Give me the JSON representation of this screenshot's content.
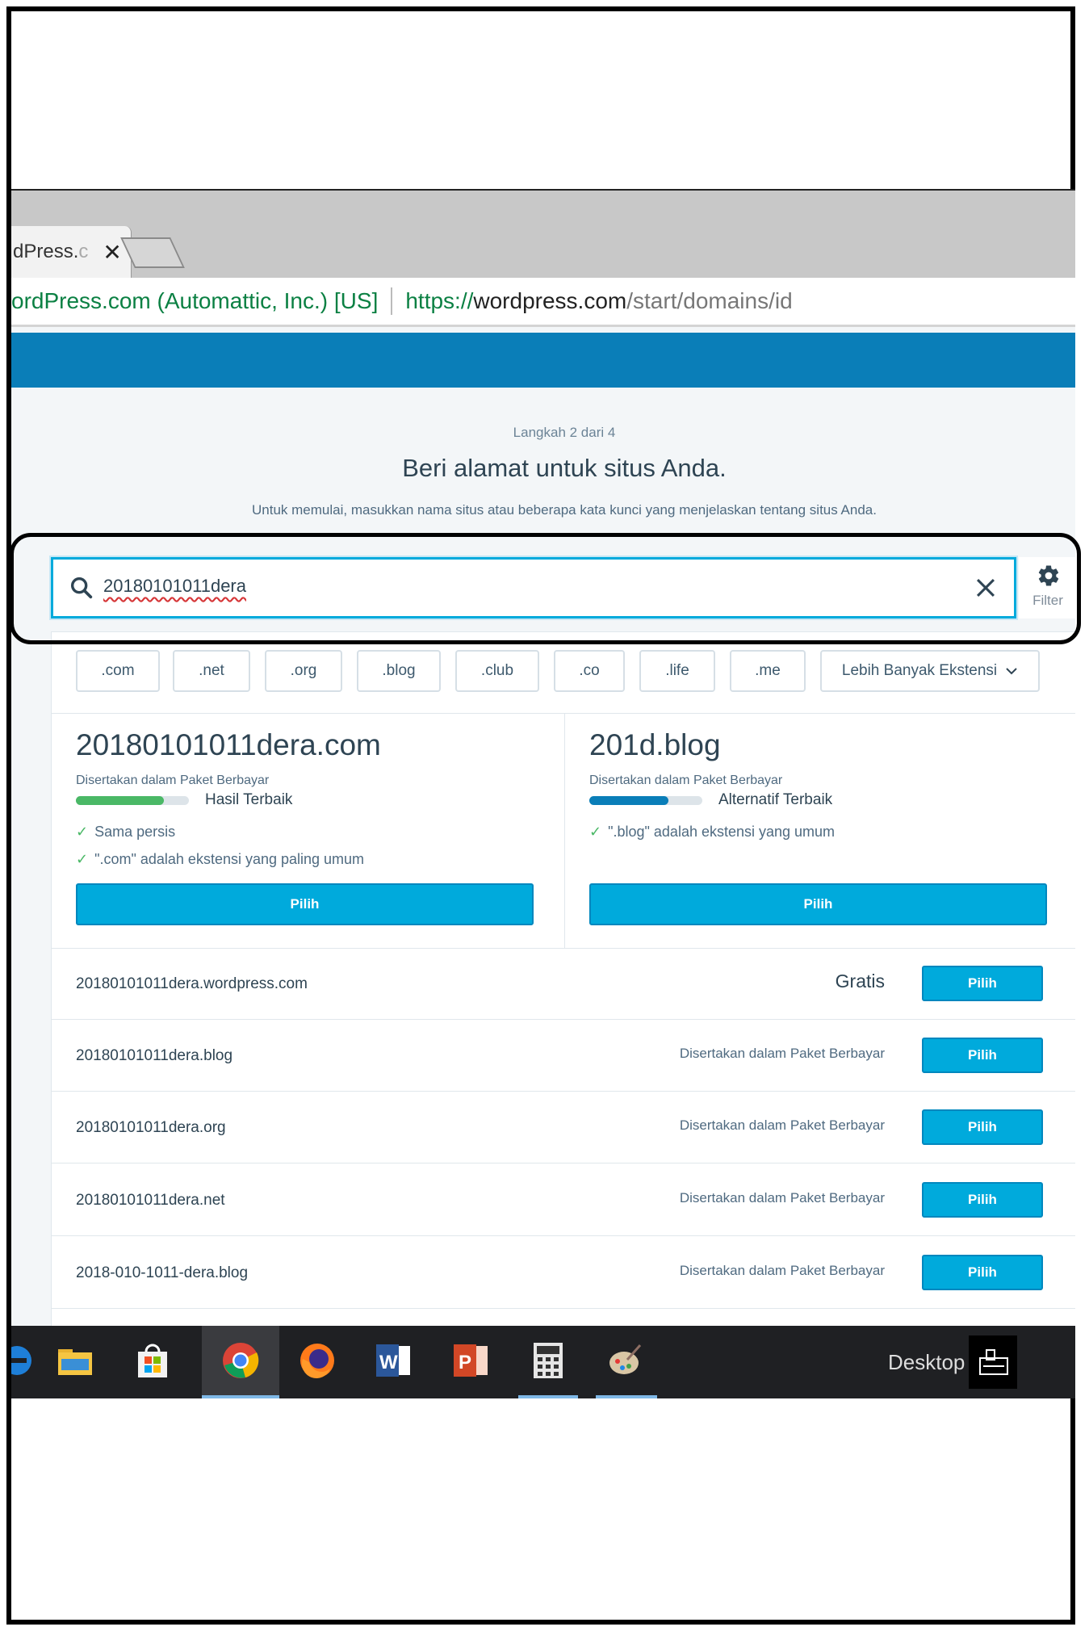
{
  "browser": {
    "tab_title_visible": "dPress.",
    "tab_title_fade": "c",
    "tab_close": "✕",
    "secure_label": "ordPress.com (Automattic, Inc.) [US]",
    "url_proto": "https://",
    "url_host": "wordpress.com",
    "url_path": "/start/domains/id"
  },
  "page": {
    "step": "Langkah 2 dari 4",
    "headline": "Beri alamat untuk situs Anda.",
    "subhead": "Untuk memulai, masukkan nama situs atau beberapa kata kunci yang menjelaskan tentang situs Anda."
  },
  "search": {
    "value": "20180101011dera",
    "filter_label": "Filter"
  },
  "tlds": [
    ".com",
    ".net",
    ".org",
    ".blog",
    ".club",
    ".co",
    ".life",
    ".me"
  ],
  "more_extensions": "Lebih Banyak Ekstensi",
  "featured": [
    {
      "name": "20180101011dera.com",
      "sub": "Disertakan dalam Paket Berbayar",
      "badge": "Hasil Terbaik",
      "score": 0.78,
      "bar_color": "#4ab866",
      "checks": [
        "Sama persis",
        "\".com\" adalah ekstensi yang paling umum"
      ],
      "button": "Pilih"
    },
    {
      "name": "201d.blog",
      "sub": "Disertakan dalam Paket Berbayar",
      "badge": "Alternatif Terbaik",
      "score": 0.7,
      "bar_color": "#0a7eb8",
      "checks": [
        "\".blog\" adalah ekstensi yang umum"
      ],
      "button": "Pilih"
    }
  ],
  "results": [
    {
      "name": "20180101011dera.wordpress.com",
      "price": "Gratis",
      "button": "Pilih"
    },
    {
      "name": "20180101011dera.blog",
      "price": "Disertakan dalam Paket Berbayar",
      "button": "Pilih"
    },
    {
      "name": "20180101011dera.org",
      "price": "Disertakan dalam Paket Berbayar",
      "button": "Pilih"
    },
    {
      "name": "20180101011dera.net",
      "price": "Disertakan dalam Paket Berbayar",
      "button": "Pilih"
    },
    {
      "name": "2018-010-1011-dera.blog",
      "price": "Disertakan dalam Paket Berbayar",
      "button": "Pilih"
    }
  ],
  "taskbar": {
    "desktop_label": "Desktop",
    "icons": [
      "edge-icon",
      "file-explorer-icon",
      "store-icon",
      "chrome-icon",
      "firefox-icon",
      "word-icon",
      "powerpoint-icon",
      "calculator-icon",
      "paint-icon"
    ]
  },
  "colors": {
    "accent": "#00aadc",
    "wp_blue": "#0a7eb8"
  }
}
